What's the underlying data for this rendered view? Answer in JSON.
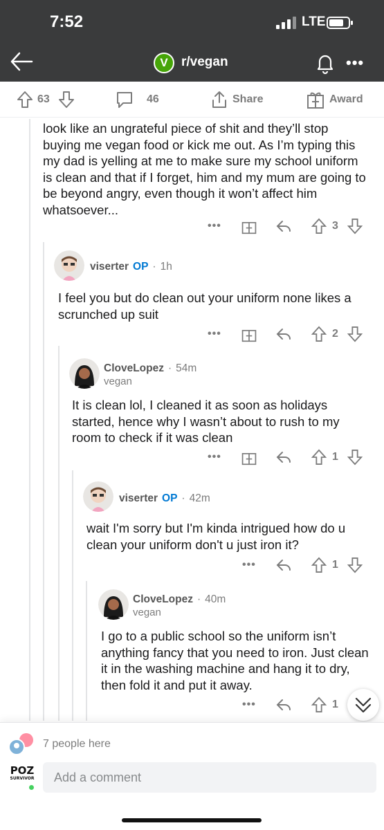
{
  "status_bar": {
    "time": "7:52",
    "network": "LTE"
  },
  "header": {
    "subreddit": "r/vegan",
    "logo_letter": "V"
  },
  "post_actions": {
    "upvotes": "63",
    "comments": "46",
    "share_label": "Share",
    "award_label": "Award"
  },
  "comments": [
    {
      "text": "look like an ungrateful piece of shit and they’ll stop buying me vegan food or kick me out. As I’m typing this my dad is yelling at me to make sure my school uniform is clean and that if I forget, him and my mum are going to be beyond angry, even though it won’t affect him whatsoever...",
      "score": "3"
    },
    {
      "author": "viserter",
      "op_badge": "OP",
      "time": "1h",
      "text": "I feel you but do clean out your uniform none likes a scrunched up suit",
      "score": "2"
    },
    {
      "author": "CloveLopez",
      "time": "54m",
      "flair": "vegan",
      "text": "It is clean lol, I cleaned it as soon as holidays started, hence why I wasn’t about to rush to my room to check if it was clean",
      "score": "1"
    },
    {
      "author": "viserter",
      "op_badge": "OP",
      "time": "42m",
      "text": "wait I'm sorry but I'm kinda intrigued how do u clean your uniform don't u just iron it?",
      "score": "1"
    },
    {
      "author": "CloveLopez",
      "time": "40m",
      "flair": "vegan",
      "text": "I go to a public school so the uniform isn’t anything fancy that you need to iron. Just clean it in the washing machine and hang it to dry, then fold it and put it away.",
      "score": "1"
    }
  ],
  "composer": {
    "people_here": "7 people here",
    "placeholder": "Add a comment",
    "user_badge_text": "POZ",
    "user_badge_sub": "SURVIVOR"
  },
  "colors": {
    "header_bg": "#3a3b3c",
    "op_blue": "#0079d3",
    "subreddit_green": "#46a508",
    "meta_gray": "#7c7c7c"
  }
}
